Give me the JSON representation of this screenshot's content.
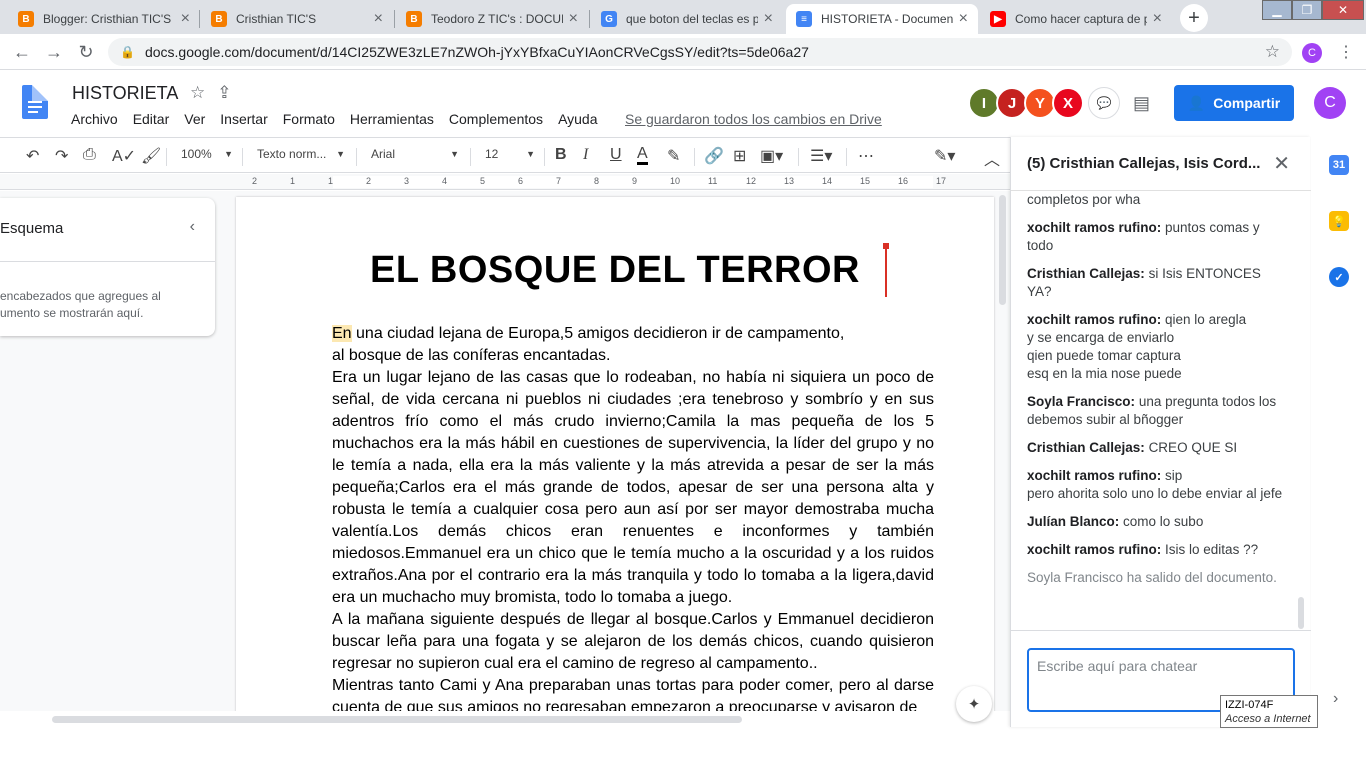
{
  "browser": {
    "tabs": [
      {
        "title": "Blogger: Cristhian TIC'S -",
        "favicon": "B",
        "color": "#f57d00"
      },
      {
        "title": "Cristhian TIC'S",
        "favicon": "B",
        "color": "#f57d00"
      },
      {
        "title": "Teodoro Z TIC's : DOCUM",
        "favicon": "B",
        "color": "#f57d00"
      },
      {
        "title": "que boton del teclas es p",
        "favicon": "G",
        "color": "#4285f4"
      },
      {
        "title": "HISTORIETA - Document",
        "favicon": "≡",
        "color": "#4285f4"
      },
      {
        "title": "Como hacer captura de p",
        "favicon": "▶",
        "color": "#ff0000"
      }
    ],
    "url": "docs.google.com/document/d/14CI25ZWE3zLE7nZWOh-jYxYBfxaCuYIAonCRVeCgsSY/edit?ts=5de06a27",
    "profile_initial": "C"
  },
  "docs": {
    "title": "HISTORIETA",
    "menu": [
      "Archivo",
      "Editar",
      "Ver",
      "Insertar",
      "Formato",
      "Herramientas",
      "Complementos",
      "Ayuda"
    ],
    "saved_status": "Se guardaron todos los cambios en Drive",
    "collaborators": [
      {
        "initial": "I",
        "color": "#5f7a2a"
      },
      {
        "initial": "J",
        "color": "#c5221f"
      },
      {
        "initial": "Y",
        "color": "#f4511e"
      },
      {
        "initial": "X",
        "color": "#e8071e"
      }
    ],
    "share_label": "Compartir",
    "user_initial": "C",
    "toolbar": {
      "zoom": "100%",
      "style": "Texto norm...",
      "font": "Arial",
      "size": "12"
    },
    "ruler_numbers": [
      "2",
      "1",
      "1",
      "2",
      "3",
      "4",
      "5",
      "6",
      "7",
      "8",
      "9",
      "10",
      "11",
      "12",
      "13",
      "14",
      "15",
      "16",
      "17"
    ],
    "outline": {
      "title": "Esquema",
      "hint_line1": "encabezados que agregues al",
      "hint_line2": "umento se mostrarán aquí."
    },
    "heading": "EL BOSQUE DEL TERROR",
    "para1_hl": "En",
    "para1": " una ciudad lejana de Europa,5 amigos decidieron ir de campamento,",
    "para2": "al bosque de las coníferas encantadas.",
    "para3": "Era un lugar lejano de las casas que lo rodeaban, no había ni siquiera un poco de señal, de vida cercana ni pueblos ni ciudades ;era tenebroso y sombrío y en sus adentros frío como el más crudo invierno;Camila la mas pequeña de los 5 muchachos era la más hábil en cuestiones de supervivencia, la líder del grupo y no le temía a nada, ella era la más valiente y la más atrevida a pesar de ser la más pequeña;Carlos era el más grande de todos, apesar de ser una persona alta y robusta le temía a cualquier cosa pero aun así por ser mayor demostraba mucha valentía.Los demás chicos eran renuentes e inconformes y también miedosos.Emmanuel era un chico que le temía mucho a la oscuridad y a los ruidos extraños.Ana por el contrario era la más tranquila y todo lo tomaba a la ligera,david era un muchacho muy bromista, todo lo tomaba a juego.",
    "para4": "A la mañana siguiente después de llegar al bosque.Carlos y Emmanuel decidieron buscar leña para una fogata y se alejaron de los demás chicos, cuando quisieron regresar no supieron cual era el camino de regreso al campamento..",
    "para5": "Mientras tanto Cami y Ana preparaban unas tortas para poder comer, pero al darse cuenta de que sus amigos no regresaban empezaron a preocuparse y avisaron de"
  },
  "chat": {
    "title": "(5) Cristhian Callejas, Isis Cord...",
    "messages": [
      {
        "author": "",
        "lines": [
          "completos por wha"
        ]
      },
      {
        "author": "xochilt ramos rufino:",
        "lines": [
          "puntos comas y todo"
        ]
      },
      {
        "author": "Cristhian Callejas:",
        "lines": [
          "si Isis ENTONCES YA?"
        ]
      },
      {
        "author": "xochilt ramos rufino:",
        "lines": [
          "qien lo aregla",
          "y se encarga de enviarlo",
          "qien puede tomar captura",
          "esq en la mia nose puede"
        ]
      },
      {
        "author": "Soyla Francisco:",
        "lines": [
          "una pregunta todos los debemos subir al bñogger"
        ]
      },
      {
        "author": "Cristhian Callejas:",
        "lines": [
          "CREO QUE SI"
        ]
      },
      {
        "author": "xochilt ramos rufino:",
        "lines": [
          "sip",
          "pero ahorita solo uno lo debe enviar al jefe"
        ]
      },
      {
        "author": "Julían Blanco:",
        "lines": [
          "como lo subo"
        ]
      },
      {
        "author": "xochilt ramos rufino:",
        "lines": [
          "Isis lo editas ??"
        ]
      }
    ],
    "system_message": "Soyla Francisco ha salido del documento.",
    "input_placeholder": "Escribe aquí para chatear"
  },
  "tooltip": {
    "line1": "IZZI-074F",
    "line2": "Acceso a Internet"
  }
}
